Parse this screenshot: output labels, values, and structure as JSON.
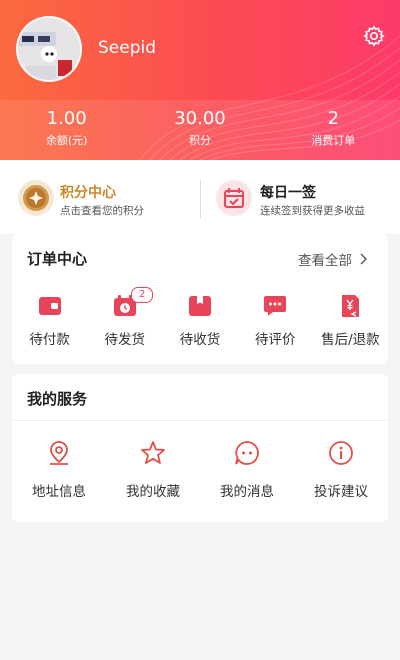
{
  "profile": {
    "username": "Seepid"
  },
  "stats": [
    {
      "value": "1.00",
      "label": "余额(元)"
    },
    {
      "value": "30.00",
      "label": "积分"
    },
    {
      "value": "2",
      "label": "消费订单"
    }
  ],
  "quick": {
    "points": {
      "title": "积分中心",
      "subtitle": "点击查看您的积分"
    },
    "checkin": {
      "title": "每日一签",
      "subtitle": "连续签到获得更多收益"
    }
  },
  "orders": {
    "title": "订单中心",
    "see_all": "查看全部",
    "items": [
      {
        "label": "待付款",
        "icon": "wallet-icon"
      },
      {
        "label": "待发货",
        "icon": "clock-box-icon",
        "badge": "2"
      },
      {
        "label": "待收货",
        "icon": "package-icon"
      },
      {
        "label": "待评价",
        "icon": "chat-bubble-icon"
      },
      {
        "label": "售后/退款",
        "icon": "refund-icon"
      }
    ]
  },
  "services": {
    "title": "我的服务",
    "items": [
      {
        "label": "地址信息",
        "icon": "location-pin-icon"
      },
      {
        "label": "我的收藏",
        "icon": "star-icon"
      },
      {
        "label": "我的消息",
        "icon": "message-icon"
      },
      {
        "label": "投诉建议",
        "icon": "info-icon"
      }
    ]
  },
  "colors": {
    "header_start": "#fb6a3e",
    "header_end": "#fd3a6a",
    "accent": "#e8445a",
    "points_gold": "#c8882a"
  }
}
